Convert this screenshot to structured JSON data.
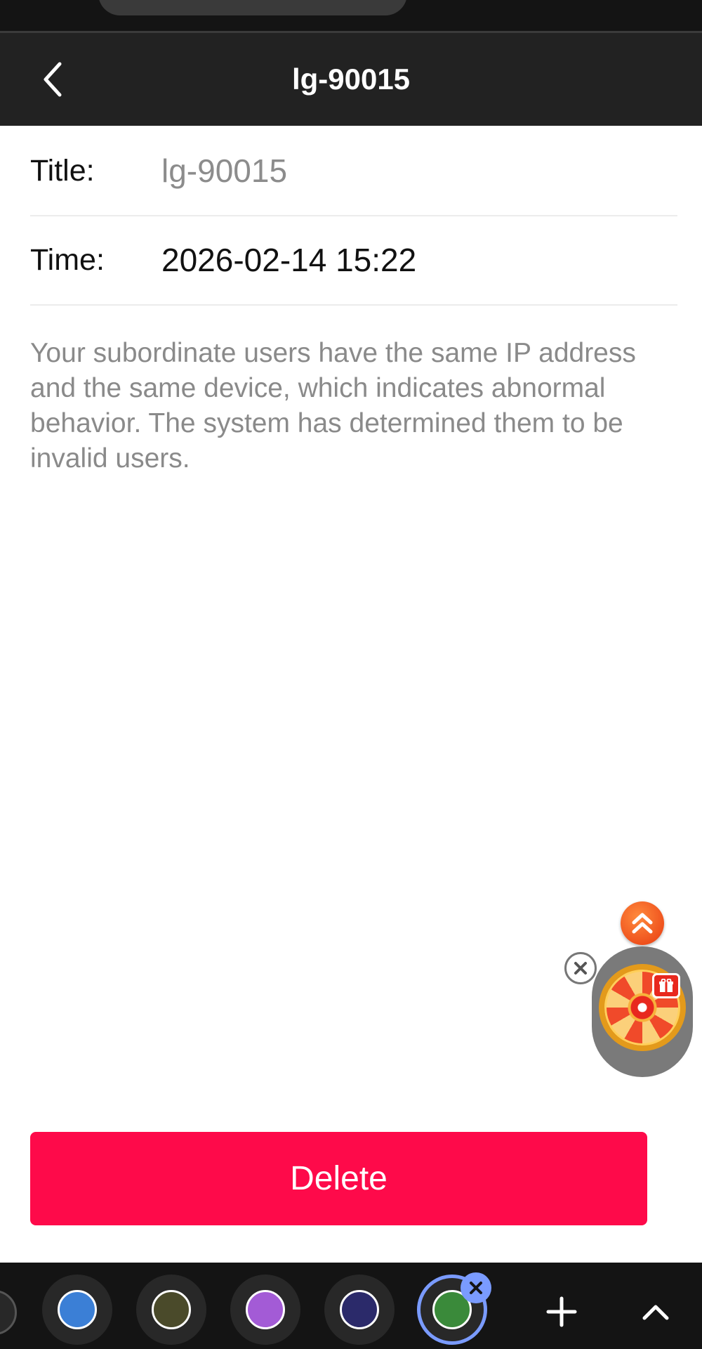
{
  "header": {
    "title": "lg-90015",
    "back_icon": "chevron-left-icon"
  },
  "detail": {
    "title_label": "Title:",
    "title_value": "lg-90015",
    "time_label": "Time:",
    "time_value": "2026-02-14 15:22",
    "message": "Your subordinate users have the same IP address and the same device, which indicates abnormal behavior. The system has determined them to be invalid users."
  },
  "actions": {
    "delete_label": "Delete"
  },
  "floating_widget": {
    "scroll_up_icon": "double-chevron-up-icon",
    "close_icon": "close-icon",
    "wheel_icon": "prize-wheel-icon",
    "gift_icon": "gift-icon"
  },
  "bottom_bar": {
    "apps": [
      {
        "icon": "app-icon-1",
        "color": "#3b7fd6"
      },
      {
        "icon": "app-icon-2",
        "color": "#4a4a2a"
      },
      {
        "icon": "app-icon-3",
        "color": "#a35bd6"
      },
      {
        "icon": "app-icon-4",
        "color": "#2b2a6a"
      },
      {
        "icon": "app-icon-5",
        "color": "#3a8a3a",
        "active": true
      }
    ],
    "add_icon": "plus-icon",
    "expand_icon": "chevron-up-icon"
  },
  "colors": {
    "header_bg": "#222222",
    "delete_bg": "#fe0a4a",
    "active_ring": "#7a9bff"
  }
}
